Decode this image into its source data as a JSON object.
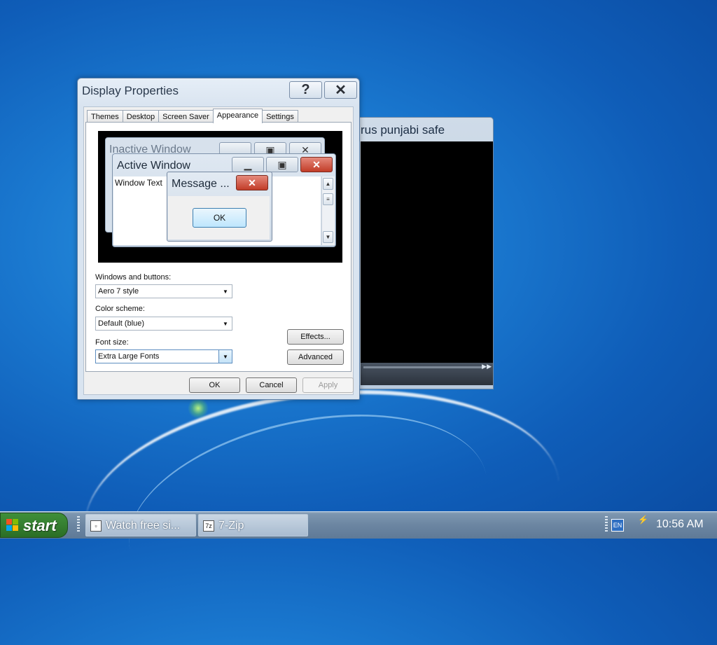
{
  "background_window": {
    "title": "rus punjabi safe",
    "fast_forward_icon": "fast-forward-icon"
  },
  "dialog": {
    "title": "Display Properties",
    "help_label": "?",
    "close_label": "✕",
    "tabs": [
      "Themes",
      "Desktop",
      "Screen Saver",
      "Appearance",
      "Settings"
    ],
    "active_tab": "Appearance",
    "preview": {
      "inactive_title": "Inactive Window",
      "active_title": "Active Window",
      "window_text": "Window Text",
      "message_title": "Message ...",
      "message_ok": "OK"
    },
    "windows_buttons_label": "Windows and buttons:",
    "windows_buttons_value": "Aero 7 style",
    "color_scheme_label": "Color scheme:",
    "color_scheme_value": "Default (blue)",
    "font_size_label": "Font size:",
    "font_size_value": "Extra Large Fonts",
    "effects_label": "Effects...",
    "advanced_label": "Advanced",
    "ok_label": "OK",
    "cancel_label": "Cancel",
    "apply_label": "Apply"
  },
  "taskbar": {
    "start_label": "start",
    "items": [
      {
        "label": "Watch free si...",
        "icon": "window-icon"
      },
      {
        "label": "7-Zip",
        "icon": "7zip-icon",
        "icon_text": "7z"
      }
    ],
    "lang": "EN",
    "clock": "10:56 AM"
  },
  "colors": {
    "desktop": "#1a78cf",
    "start_green": "#3f8f3a",
    "close_red": "#c23c28"
  }
}
